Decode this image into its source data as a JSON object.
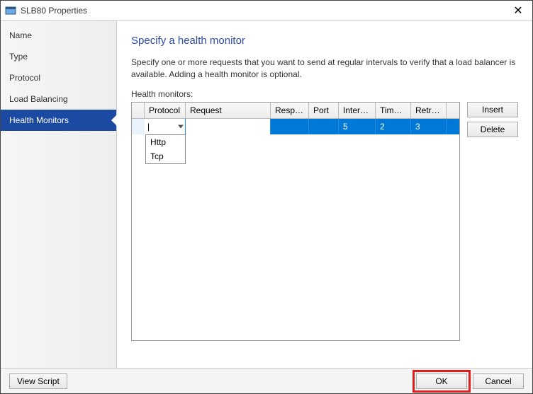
{
  "window": {
    "title": "SLB80 Properties",
    "close_symbol": "✕"
  },
  "sidebar": {
    "items": [
      {
        "label": "Name"
      },
      {
        "label": "Type"
      },
      {
        "label": "Protocol"
      },
      {
        "label": "Load Balancing"
      },
      {
        "label": "Health Monitors"
      }
    ]
  },
  "main": {
    "heading": "Specify a health monitor",
    "description": "Specify one or more requests that you want to send at regular intervals to verify that a load balancer is available. Adding a health monitor is optional.",
    "list_label": "Health monitors:",
    "columns": {
      "protocol": "Protocol",
      "request": "Request",
      "response": "Respo…",
      "port": "Port",
      "interval": "Interval",
      "timeout": "Time-…",
      "retries": "Retries"
    },
    "row": {
      "protocol": "",
      "request": "",
      "response": "",
      "port": "",
      "interval": "5",
      "timeout": "2",
      "retries": "3"
    },
    "protocol_options": [
      "Http",
      "Tcp"
    ],
    "buttons": {
      "insert": "Insert",
      "delete": "Delete"
    }
  },
  "footer": {
    "view_script": "View Script",
    "ok": "OK",
    "cancel": "Cancel"
  }
}
